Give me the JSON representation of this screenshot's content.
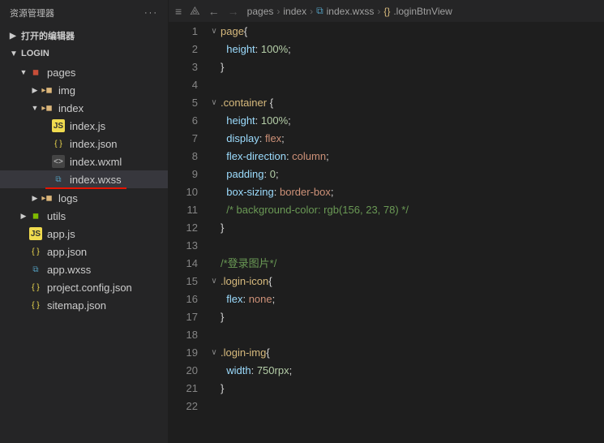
{
  "sidebar": {
    "title": "资源管理器",
    "section_open": "打开的编辑器",
    "project_name": "LOGIN",
    "tree": [
      {
        "indent": 1,
        "chev": "▼",
        "icon": "folder-red",
        "label": "pages"
      },
      {
        "indent": 2,
        "chev": "▶",
        "icon": "folder",
        "label": "img"
      },
      {
        "indent": 2,
        "chev": "▼",
        "icon": "folder",
        "label": "index"
      },
      {
        "indent": 3,
        "chev": "",
        "icon": "js",
        "label": "index.js"
      },
      {
        "indent": 3,
        "chev": "",
        "icon": "json",
        "label": "index.json"
      },
      {
        "indent": 3,
        "chev": "",
        "icon": "wxml",
        "label": "index.wxml"
      },
      {
        "indent": 3,
        "chev": "",
        "icon": "wxss",
        "label": "index.wxss",
        "active": true,
        "underline": true
      },
      {
        "indent": 2,
        "chev": "▶",
        "icon": "folder",
        "label": "logs"
      },
      {
        "indent": 1,
        "chev": "▶",
        "icon": "folder-green",
        "label": "utils"
      },
      {
        "indent": 1,
        "chev": "",
        "icon": "js",
        "label": "app.js"
      },
      {
        "indent": 1,
        "chev": "",
        "icon": "json",
        "label": "app.json"
      },
      {
        "indent": 1,
        "chev": "",
        "icon": "wxss",
        "label": "app.wxss"
      },
      {
        "indent": 1,
        "chev": "",
        "icon": "json",
        "label": "project.config.json"
      },
      {
        "indent": 1,
        "chev": "",
        "icon": "json",
        "label": "sitemap.json"
      }
    ]
  },
  "breadcrumb": {
    "items": [
      "pages",
      "index",
      "index.wxss",
      ".loginBtnView"
    ]
  },
  "code": {
    "lines": [
      {
        "n": 1,
        "fold": "∨",
        "html": "<span class='tok-sel'>page</span><span class='tok-brace'>{</span>"
      },
      {
        "n": 2,
        "fold": "",
        "html": "  <span class='tok-prop'>height</span><span class='tok-punc'>: </span><span class='tok-num'>100%</span><span class='tok-punc'>;</span>"
      },
      {
        "n": 3,
        "fold": "",
        "html": "<span class='tok-brace'>}</span>"
      },
      {
        "n": 4,
        "fold": "",
        "html": ""
      },
      {
        "n": 5,
        "fold": "∨",
        "html": "<span class='tok-sel'>.container</span> <span class='tok-brace'>{</span>"
      },
      {
        "n": 6,
        "fold": "",
        "html": "  <span class='tok-prop'>height</span><span class='tok-punc'>: </span><span class='tok-num'>100%</span><span class='tok-punc'>;</span>"
      },
      {
        "n": 7,
        "fold": "",
        "html": "  <span class='tok-prop'>display</span><span class='tok-punc'>: </span><span class='tok-val'>flex</span><span class='tok-punc'>;</span>"
      },
      {
        "n": 8,
        "fold": "",
        "html": "  <span class='tok-prop'>flex-direction</span><span class='tok-punc'>: </span><span class='tok-val'>column</span><span class='tok-punc'>;</span>"
      },
      {
        "n": 9,
        "fold": "",
        "html": "  <span class='tok-prop'>padding</span><span class='tok-punc'>: </span><span class='tok-num'>0</span><span class='tok-punc'>;</span>"
      },
      {
        "n": 10,
        "fold": "",
        "html": "  <span class='tok-prop'>box-sizing</span><span class='tok-punc'>: </span><span class='tok-val'>border-box</span><span class='tok-punc'>;</span>"
      },
      {
        "n": 11,
        "fold": "",
        "html": "  <span class='tok-comment'>/* background-color: rgb(156, 23, 78) */</span>"
      },
      {
        "n": 12,
        "fold": "",
        "html": "<span class='tok-brace'>}</span>"
      },
      {
        "n": 13,
        "fold": "",
        "html": ""
      },
      {
        "n": 14,
        "fold": "",
        "html": "<span class='tok-comment'>/*登录图片*/</span>"
      },
      {
        "n": 15,
        "fold": "∨",
        "html": "<span class='tok-sel'>.login-icon</span><span class='tok-brace'>{</span>"
      },
      {
        "n": 16,
        "fold": "",
        "html": "  <span class='tok-prop'>flex</span><span class='tok-punc'>: </span><span class='tok-val'>none</span><span class='tok-punc'>;</span>"
      },
      {
        "n": 17,
        "fold": "",
        "html": "<span class='tok-brace'>}</span>"
      },
      {
        "n": 18,
        "fold": "",
        "html": ""
      },
      {
        "n": 19,
        "fold": "∨",
        "html": "<span class='tok-sel'>.login-img</span><span class='tok-brace'>{</span>"
      },
      {
        "n": 20,
        "fold": "",
        "html": "  <span class='tok-prop'>width</span><span class='tok-punc'>: </span><span class='tok-num'>750rpx</span><span class='tok-punc'>;</span>"
      },
      {
        "n": 21,
        "fold": "",
        "html": "<span class='tok-brace'>}</span>"
      },
      {
        "n": 22,
        "fold": "",
        "html": ""
      }
    ]
  }
}
